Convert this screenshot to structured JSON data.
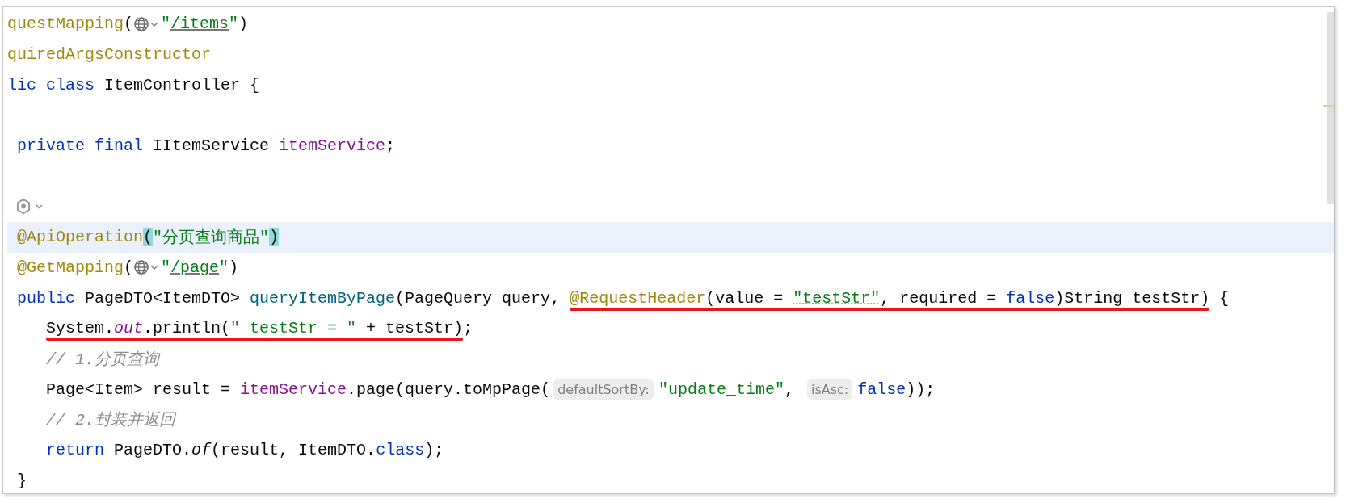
{
  "editor": {
    "lines": [
      {
        "current": false,
        "tokens": [
          {
            "kind": "annotation",
            "text": "questMapping"
          },
          {
            "kind": "plain",
            "text": "("
          },
          {
            "kind": "globe"
          },
          {
            "kind": "string",
            "text": "\""
          },
          {
            "kind": "link",
            "text": "/items"
          },
          {
            "kind": "string",
            "text": "\""
          },
          {
            "kind": "plain",
            "text": ")"
          }
        ]
      },
      {
        "current": false,
        "tokens": [
          {
            "kind": "annotation",
            "text": "quiredArgsConstructor"
          }
        ]
      },
      {
        "current": false,
        "tokens": [
          {
            "kind": "keyword",
            "text": "lic class"
          },
          {
            "kind": "plain",
            "text": " ItemController {"
          }
        ]
      },
      {
        "current": false
      },
      {
        "current": false,
        "tokens": [
          {
            "kind": "keyword",
            "text": " private final"
          },
          {
            "kind": "plain",
            "text": " IItemService "
          },
          {
            "kind": "field",
            "text": "itemService"
          },
          {
            "kind": "plain",
            "text": ";"
          }
        ]
      },
      {
        "current": false
      },
      {
        "current": false,
        "tokens": [
          {
            "kind": "inlay"
          }
        ]
      },
      {
        "current": true,
        "tokens": [
          {
            "kind": "annotation",
            "text": " @ApiOperation"
          },
          {
            "kind": "bracket",
            "text": "("
          },
          {
            "kind": "string",
            "text": "\"分页查询商品\""
          },
          {
            "kind": "bracket",
            "text": ")"
          }
        ]
      },
      {
        "current": false,
        "tokens": [
          {
            "kind": "annotation",
            "text": " @GetMapping"
          },
          {
            "kind": "plain",
            "text": "("
          },
          {
            "kind": "globe"
          },
          {
            "kind": "string",
            "text": "\""
          },
          {
            "kind": "link",
            "text": "/page"
          },
          {
            "kind": "string",
            "text": "\""
          },
          {
            "kind": "plain",
            "text": ")"
          }
        ]
      },
      {
        "current": false,
        "tokens": [
          {
            "kind": "keyword",
            "text": " public"
          },
          {
            "kind": "plain",
            "text": " PageDTO<ItemDTO> "
          },
          {
            "kind": "method",
            "text": "queryItemByPage"
          },
          {
            "kind": "plain",
            "text": "(PageQuery query, "
          },
          {
            "kind": "group",
            "underlined": true,
            "tokens": [
              {
                "kind": "annotation",
                "text": "@RequestHeader"
              },
              {
                "kind": "plain",
                "text": "(value = "
              },
              {
                "kind": "typo-string",
                "text": "\"testStr\""
              },
              {
                "kind": "plain",
                "text": ", required = "
              },
              {
                "kind": "keyword",
                "text": "false"
              },
              {
                "kind": "plain",
                "text": ")String testStr)"
              }
            ]
          },
          {
            "kind": "plain",
            "text": " {"
          }
        ]
      },
      {
        "current": false,
        "tokens": [
          {
            "kind": "group",
            "underlined": true,
            "tokens": [
              {
                "kind": "plain",
                "text": "System."
              },
              {
                "kind": "static-field",
                "text": "out"
              },
              {
                "kind": "plain",
                "text": ".println("
              },
              {
                "kind": "string",
                "text": "\" testStr = \""
              },
              {
                "kind": "plain",
                "text": " + testStr)"
              }
            ]
          },
          {
            "kind": "plain",
            "text": ";"
          }
        ]
      },
      {
        "current": false,
        "tokens": [
          {
            "kind": "comment",
            "text": "    // 1.分页查询"
          }
        ]
      },
      {
        "current": false,
        "tokens": [
          {
            "kind": "plain",
            "text": "    Page<Item> result = "
          },
          {
            "kind": "field",
            "text": "itemService"
          },
          {
            "kind": "plain",
            "text": ".page(query.toMpPage("
          },
          {
            "kind": "hint",
            "text": "defaultSortBy:"
          },
          {
            "kind": "string",
            "text": "\"update_time\""
          },
          {
            "kind": "plain",
            "text": ", "
          },
          {
            "kind": "hint",
            "text": "isAsc:"
          },
          {
            "kind": "keyword",
            "text": "false"
          },
          {
            "kind": "plain",
            "text": "));"
          }
        ]
      },
      {
        "current": false,
        "tokens": [
          {
            "kind": "comment",
            "text": "    // 2.封装并返回"
          }
        ]
      },
      {
        "current": false,
        "tokens": [
          {
            "kind": "keyword",
            "text": "    return"
          },
          {
            "kind": "plain",
            "text": " PageDTO."
          },
          {
            "kind": "static-method",
            "text": "of"
          },
          {
            "kind": "plain",
            "text": "(result, ItemDTO."
          },
          {
            "kind": "keyword",
            "text": "class"
          },
          {
            "kind": "plain",
            "text": ");"
          }
        ]
      },
      {
        "current": false,
        "tokens": [
          {
            "kind": "plain",
            "text": " }"
          }
        ]
      }
    ]
  }
}
